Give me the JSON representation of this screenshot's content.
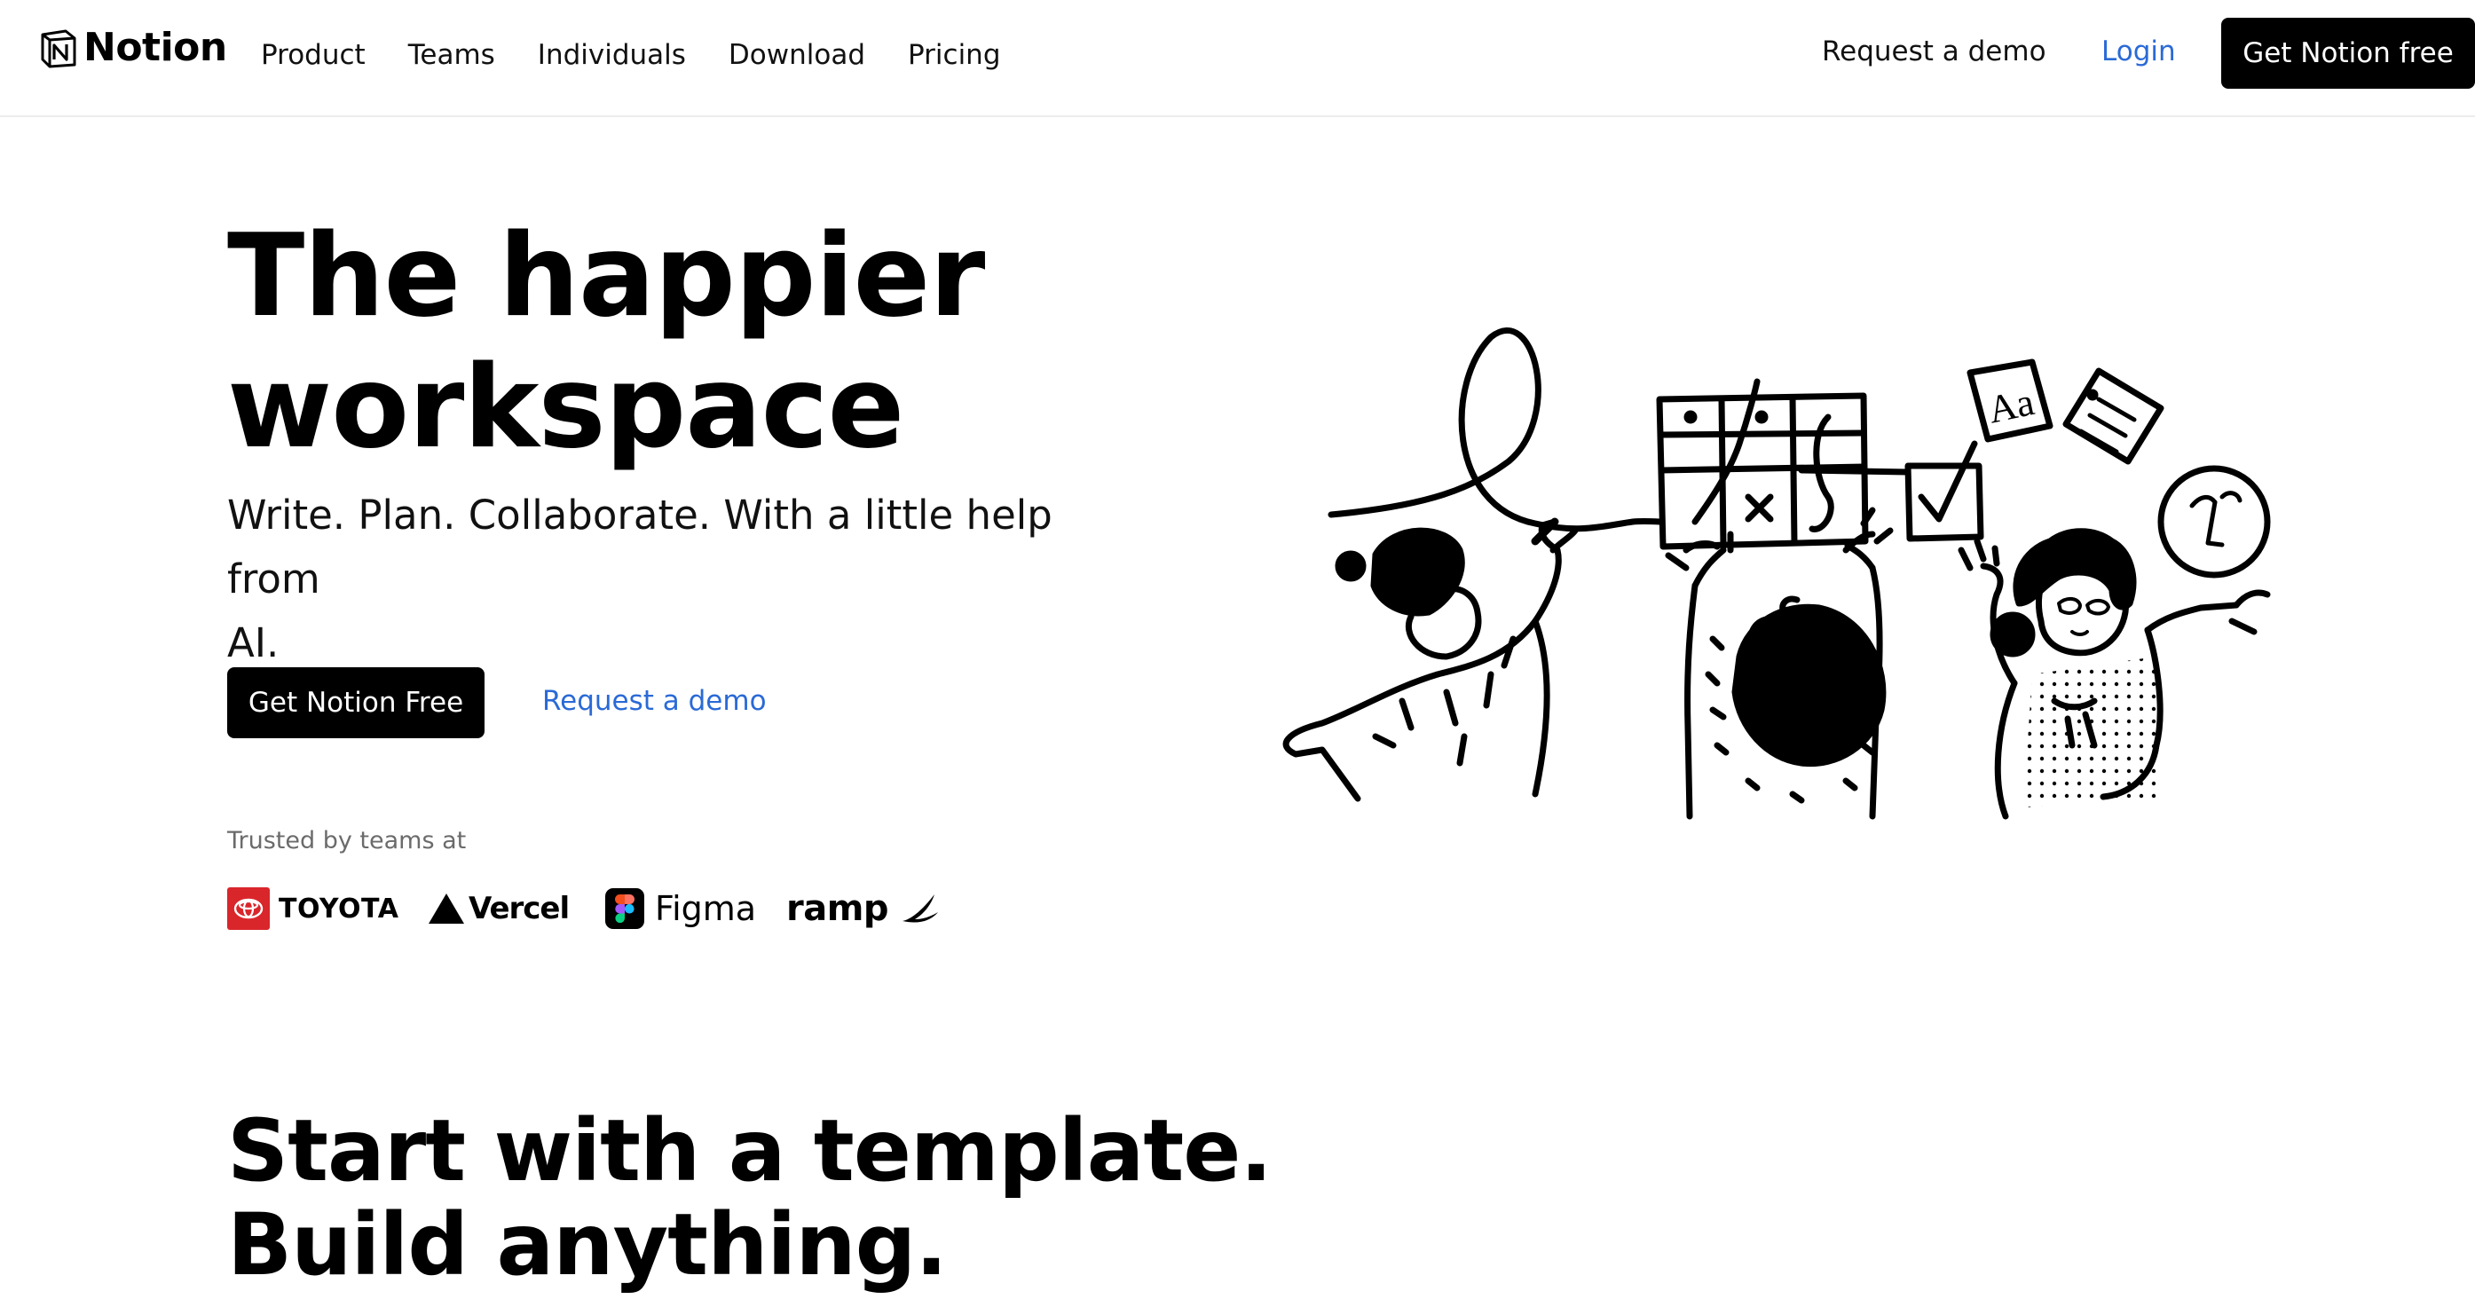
{
  "nav": {
    "logo_text": "Notion",
    "links": [
      "Product",
      "Teams",
      "Individuals",
      "Download",
      "Pricing"
    ],
    "request_demo": "Request a demo",
    "login": "Login",
    "cta": "Get Notion free"
  },
  "hero": {
    "title_line1": "The happier",
    "title_line2": "workspace",
    "subtitle_line1": "Write. Plan. Collaborate. With a little help from",
    "subtitle_line2": "AI.",
    "primary_button": "Get Notion Free",
    "secondary_link": "Request a demo",
    "trusted_label": "Trusted by teams at",
    "logos": [
      "TOYOTA",
      "Vercel",
      "Figma",
      "ramp"
    ]
  },
  "templates": {
    "title_line1": "Start with a template.",
    "title_line2": "Build anything."
  },
  "colors": {
    "accent_link": "#2a6ad6",
    "button_bg": "#000000",
    "toyota_red": "#d9262b"
  },
  "illustration": {
    "doc_icon_text": "Aa"
  }
}
